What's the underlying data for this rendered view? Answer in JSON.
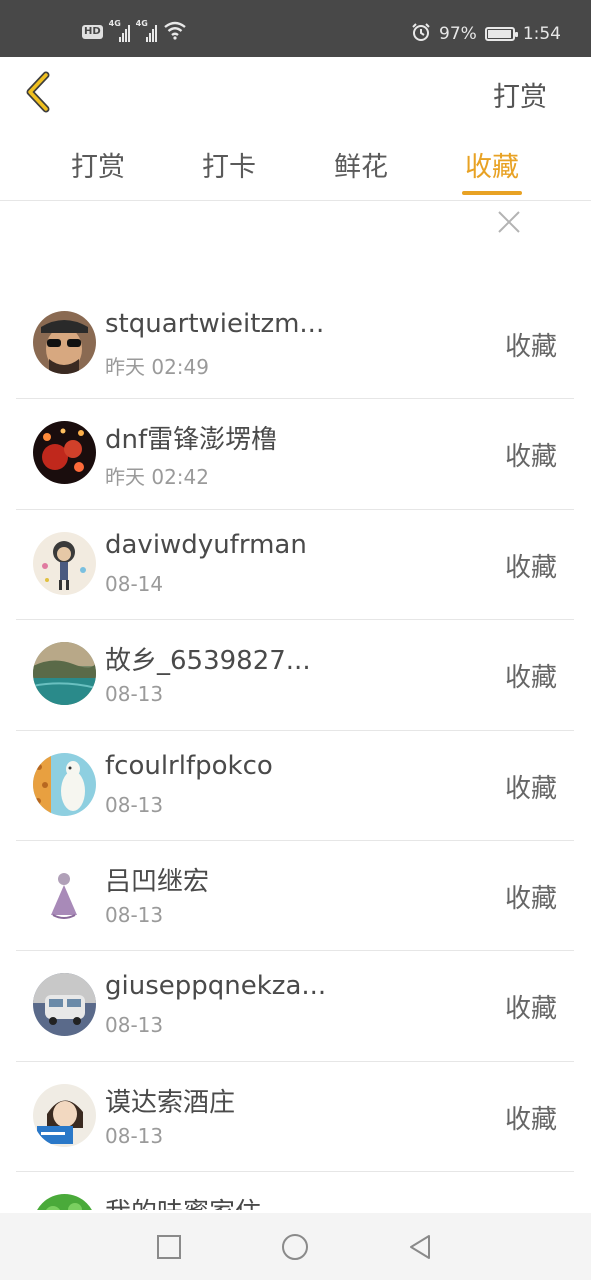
{
  "status_bar": {
    "hd_badge": "HD",
    "network_1": "4G",
    "network_2": "4G",
    "battery_percent": "97%",
    "battery_level": 0.97,
    "time": "1:54",
    "icons": [
      "hd-icon",
      "signal-icon",
      "signal-icon",
      "wifi-icon",
      "alarm-icon",
      "battery-icon"
    ]
  },
  "header": {
    "back_icon": "chevron-left-icon",
    "action_label": "打赏",
    "accent_color": "#e8a224"
  },
  "tabs": [
    {
      "label": "打赏",
      "active": false
    },
    {
      "label": "打卡",
      "active": false
    },
    {
      "label": "鲜花",
      "active": false
    },
    {
      "label": "收藏",
      "active": true
    }
  ],
  "close_icon": "close-icon",
  "list": {
    "items": [
      {
        "name": "stquartwieitzm...",
        "time": "昨天 02:49",
        "action": "收藏"
      },
      {
        "name": "dnf雷锋澎塄橹",
        "time": "昨天 02:42",
        "action": "收藏"
      },
      {
        "name": "daviwdyufrman",
        "time": "08-14",
        "action": "收藏"
      },
      {
        "name": "故乡_6539827...",
        "time": "08-13",
        "action": "收藏"
      },
      {
        "name": "fcoulrlfpokco",
        "time": "08-13",
        "action": "收藏"
      },
      {
        "name": "吕凹继宏",
        "time": "08-13",
        "action": "收藏"
      },
      {
        "name": "giuseppqnekza...",
        "time": "08-13",
        "action": "收藏"
      },
      {
        "name": "谟达索酒庄",
        "time": "08-13",
        "action": "收藏"
      },
      {
        "name": "我的味蜜家住",
        "time": "",
        "action": ""
      }
    ]
  },
  "nav_bar": {
    "icons": [
      "recent-apps-icon",
      "home-icon",
      "back-icon"
    ]
  }
}
